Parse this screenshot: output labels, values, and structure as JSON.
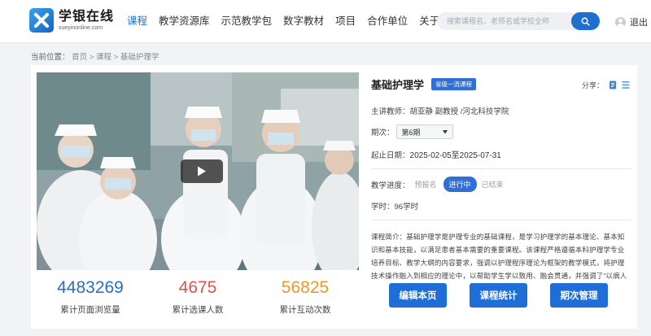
{
  "brand": {
    "name": "学银在线",
    "domain": "xueyinonline.com"
  },
  "nav": [
    {
      "label": "课程",
      "active": true
    },
    {
      "label": "教学资源库",
      "active": false
    },
    {
      "label": "示范教学包",
      "active": false
    },
    {
      "label": "数字教材",
      "active": false
    },
    {
      "label": "项目",
      "active": false
    },
    {
      "label": "合作单位",
      "active": false
    },
    {
      "label": "关于我们",
      "active": false
    }
  ],
  "search": {
    "placeholder": "搜索课程名、老师名或学校全称"
  },
  "user": {
    "logout": "退出"
  },
  "breadcrumb": {
    "prefix": "当前位置：",
    "items": [
      "首页",
      "课程",
      "基础护理学"
    ],
    "separator": ">"
  },
  "course": {
    "title": "基础护理学",
    "badge": "省级一流课程",
    "share_label": "分享：",
    "teacher_label": "主讲教师：",
    "teacher": "胡亚静 副教授 /河北科技学院",
    "term_label": "期次：",
    "term_value": "第6期",
    "date_label": "起止日期：",
    "date_value": "2025-02-05至2025-07-31",
    "progress_label": "教学进度：",
    "progress_steps": [
      {
        "label": "预报名",
        "active": false
      },
      {
        "label": "进行中",
        "active": true
      },
      {
        "label": "已结束",
        "active": false
      }
    ],
    "hours_label": "学时：",
    "hours_value": "96学时",
    "intro_label": "课程简介：",
    "intro": "基础护理学是护理专业的基础课程，是学习护理学的基本理论、基本知识和基本技能，以满足患者基本需要的重要课程。该课程严格遵循本科护理学专业培养目标、教学大纲的内容要求，强调以护理程序理论为框架的教学模式，将护理技术操作融入到相应的理论中，以帮助学生学以致用、融会贯通，并强调了“以病人为..."
  },
  "stats": [
    {
      "value": "4483269",
      "label": "累计页面浏览量",
      "color": "#2a6cc9"
    },
    {
      "value": "4675",
      "label": "累计选课人数",
      "color": "#e0524a"
    },
    {
      "value": "56825",
      "label": "累计互动次数",
      "color": "#f0952c"
    }
  ],
  "actions": [
    {
      "label": "编辑本页"
    },
    {
      "label": "课程统计"
    },
    {
      "label": "期次管理"
    }
  ],
  "colors": {
    "primary": "#1f6ed8",
    "badge": "#2f6fd6"
  }
}
